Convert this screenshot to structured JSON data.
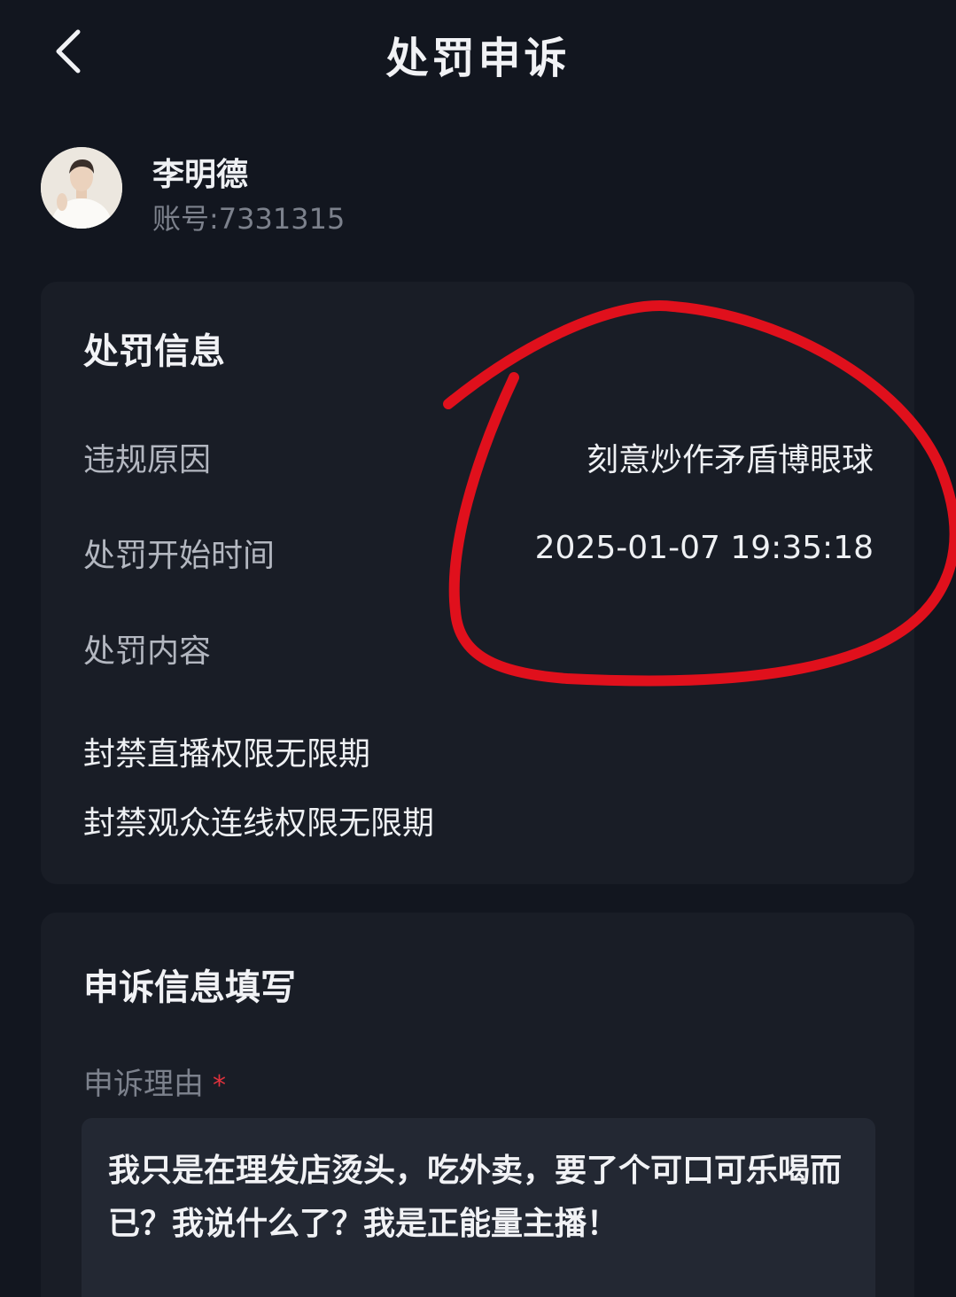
{
  "header": {
    "title": "处罚申诉"
  },
  "profile": {
    "name": "李明德",
    "account": "账号:7331315"
  },
  "penalty_card": {
    "title": "处罚信息",
    "rows": [
      {
        "label": "违规原因",
        "value": "刻意炒作矛盾博眼球"
      },
      {
        "label": "处罚开始时间",
        "value": "2025-01-07 19:35:18"
      },
      {
        "label": "处罚内容"
      }
    ],
    "content_items": [
      "封禁直播权限无限期",
      "封禁观众连线权限无限期"
    ]
  },
  "appeal_card": {
    "title": "申诉信息填写",
    "reason_label": "申诉理由",
    "required_mark": "*",
    "reason_text": "我只是在理发店烫头，吃外卖，要了个可口可乐喝而已？我说什么了？我是正能量主播！"
  },
  "colors": {
    "background": "#12161f",
    "card": "#191d26",
    "annotation_red": "#e0101c",
    "required": "#e0323d"
  }
}
